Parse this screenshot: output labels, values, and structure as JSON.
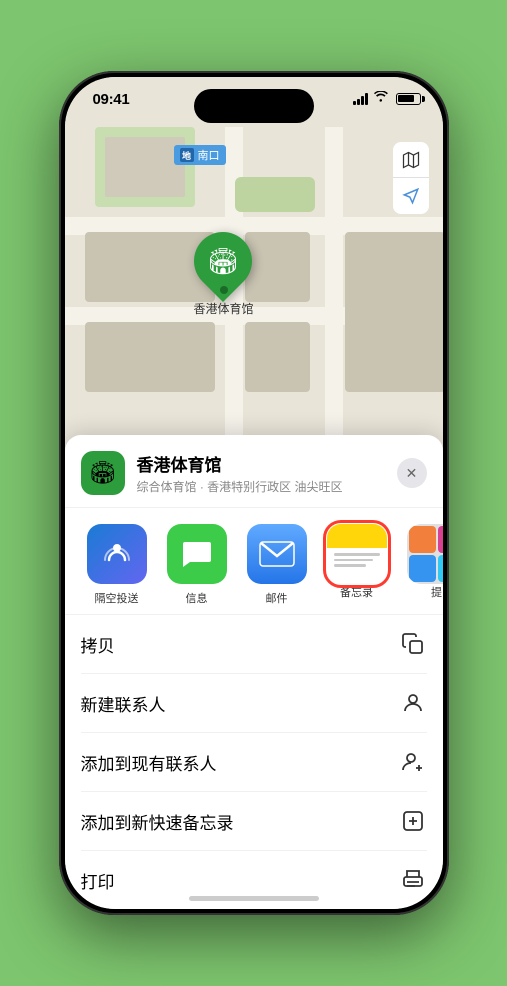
{
  "phone": {
    "status_bar": {
      "time": "09:41",
      "location_arrow": "▶"
    },
    "map": {
      "label_text": "南口",
      "pin_label": "香港体育馆",
      "map_icon": "🏟"
    },
    "controls": {
      "map_btn": "🗺",
      "location_btn": "➤"
    },
    "sheet": {
      "venue_icon": "🏟",
      "venue_name": "香港体育馆",
      "venue_subtitle": "综合体育馆 · 香港特别行政区 油尖旺区",
      "close_label": "✕",
      "share_items": [
        {
          "id": "airdrop",
          "label": "隔空投送",
          "icon": "📡"
        },
        {
          "id": "message",
          "label": "信息",
          "icon": "💬"
        },
        {
          "id": "mail",
          "label": "邮件",
          "icon": "✉"
        },
        {
          "id": "notes",
          "label": "备忘录",
          "icon": ""
        },
        {
          "id": "more",
          "label": "提",
          "icon": "···"
        }
      ],
      "actions": [
        {
          "id": "copy",
          "label": "拷贝",
          "icon": "⧉"
        },
        {
          "id": "new-contact",
          "label": "新建联系人",
          "icon": "👤"
        },
        {
          "id": "add-existing",
          "label": "添加到现有联系人",
          "icon": "👤+"
        },
        {
          "id": "add-notes",
          "label": "添加到新快速备忘录",
          "icon": "📝"
        },
        {
          "id": "print",
          "label": "打印",
          "icon": "🖨"
        }
      ]
    }
  }
}
